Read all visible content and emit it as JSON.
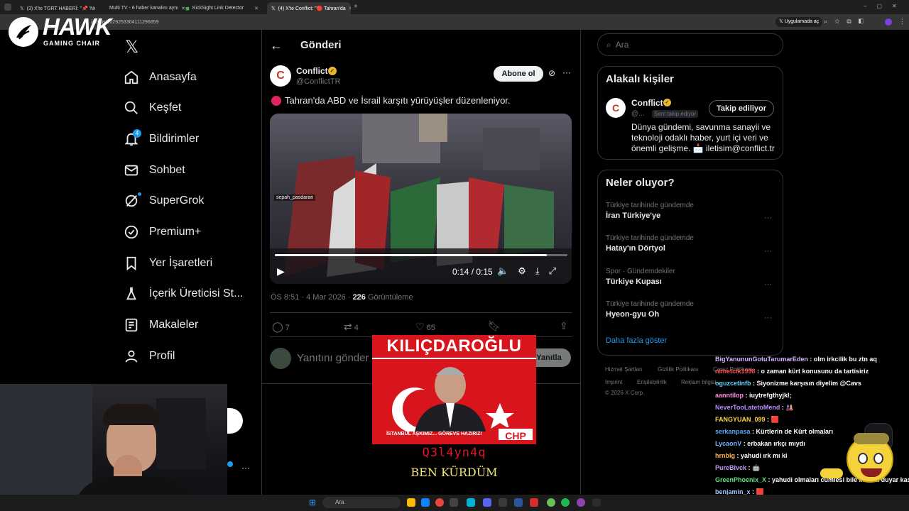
{
  "browser": {
    "tabs": [
      {
        "label": "(3) X'te TGRT HABERİ: \"📌 'Nereu"
      },
      {
        "label": "Multi TV - 6 haber kanalını aynı"
      },
      {
        "label": "KickSight Link Detector"
      },
      {
        "label": "(4) X'te Conflict: \"🔴 Tahran'da"
      }
    ],
    "url": "/status/2029253304111296859",
    "app_button": "Uygulamada aç"
  },
  "logo": {
    "brand": "HAWK",
    "sub": "GAMING CHAIR"
  },
  "nav": {
    "items": [
      "Anasayfa",
      "Keşfet",
      "Bildirimler",
      "Sohbet",
      "SuperGrok",
      "Premium+",
      "Yer İşaretleri",
      "İçerik Üreticisi St...",
      "Makaleler",
      "Profil"
    ],
    "notifications_badge": "4"
  },
  "post": {
    "header_title": "Gönderi",
    "author_name": "Conflict",
    "author_handle": "@ConflictTR",
    "subscribe_label": "Abone ol",
    "text": "Tahran'da ABD ve İsrail karşıtı yürüyüşler düzenleniyor.",
    "video_watermark": "sepah_pasdaran",
    "video_time": "0:14 / 0:15",
    "video_progress": 0.93,
    "timestamp": "ÖS 8:51 · 4 Mar 2026 ·",
    "views_count": "226",
    "views_label": "Görüntüleme",
    "replies": "7",
    "reposts": "4",
    "likes": "65",
    "reply_placeholder": "Yanıtını gönder",
    "reply_button": "Yanıtla"
  },
  "overlay": {
    "poster_title": "KILIÇDAROĞLU",
    "poster_slogan": "İSTANBUL AŞKIMIZ... GÖREVE HAZIRIZ!",
    "poster_party": "CHP",
    "caption_1": "Q3l4yn4q",
    "caption_2": "BEN KÜRDÜM"
  },
  "search": {
    "placeholder": "Ara"
  },
  "related": {
    "title": "Alakalı kişiler",
    "name": "Conflict",
    "handle": "@...",
    "follows_you": "Seni takip ediyor",
    "follow_button": "Takip ediliyor",
    "bio": "Dünya gündemi, savunma sanayii ve teknoloji odaklı haber, yurt içi veri ve önemli gelişme. 📩 iletisim@conflict.tr"
  },
  "trends": {
    "title": "Neler oluyor?",
    "items": [
      {
        "meta": "Türkiye tarihinde gündemde",
        "name": "İran Türkiye'ye"
      },
      {
        "meta": "Türkiye tarihinde gündemde",
        "name": "Hatay'ın Dörtyol"
      },
      {
        "meta": "Spor · Gündemdekiler",
        "name": "Türkiye Kupası"
      },
      {
        "meta": "Türkiye tarihinde gündemde",
        "name": "Hyeon-gyu Oh"
      }
    ],
    "show_more": "Daha fazla göster"
  },
  "footer": {
    "links": [
      "Hizmet Şartları",
      "Gizlilik Politikası",
      "Çerez Politikası",
      "Imprint",
      "Erişilebilirlik",
      "Reklam bilgisi"
    ],
    "copyright": "© 2026 X Corp."
  },
  "chat": [
    {
      "user": "BigYanununGotuTarumarEden",
      "color": "#d6b3ff",
      "msg": ": olm irkcilik bu ztn aq"
    },
    {
      "user": "nimetcik1998",
      "color": "#ff4f4f",
      "msg": ": o zaman kürt konusunu da tartisiriz"
    },
    {
      "user": "oguzcetinfb",
      "color": "#5fd0ff",
      "msg": ": Siyonizme karşısın diyelim @Cavs"
    },
    {
      "user": "aanntilop",
      "color": "#ff8ad8",
      "msg": ": iuytrefgthyjkl;"
    },
    {
      "user": "NeverTooLatetoMend",
      "color": "#b98cff",
      "msg": ": 🎎"
    },
    {
      "user": "FANGYUAN_099",
      "color": "#ffd04a",
      "msg": ": 🟥"
    },
    {
      "user": "serkanpasa",
      "color": "#5aa8ff",
      "msg": ": Kürtlerin de Kürt olmaları"
    },
    {
      "user": "LycaonV",
      "color": "#6fb8ff",
      "msg": ": erbakan ırkçı mıydı"
    },
    {
      "user": "hrnblg",
      "color": "#ffb347",
      "msg": ": yahudi ırk mı ki"
    },
    {
      "user": "PureBlvck",
      "color": "#c49bff",
      "msg": ": 🤖"
    },
    {
      "user": "GreenPhoenix_X",
      "color": "#5ee37a",
      "msg": ": yahudi olmaları cumlesi bile ırkcılık duyar kasma"
    },
    {
      "user": "benjamin_x",
      "color": "#a7c6ff",
      "msg": ": 🟥"
    }
  ],
  "taskbar": {
    "search_placeholder": "Ara",
    "time": "..."
  }
}
